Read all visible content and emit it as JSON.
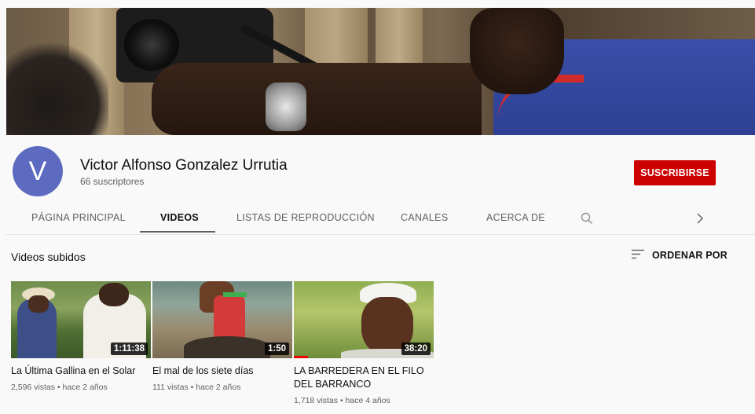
{
  "channel": {
    "avatar_letter": "V",
    "avatar_color": "#5c6bc0",
    "name": "Victor Alfonso Gonzalez Urrutia",
    "subscribers": "66 suscriptores",
    "subscribe_label": "SUSCRIBIRSE",
    "subscribe_color": "#cc0000"
  },
  "tabs": [
    {
      "label": "PÁGINA PRINCIPAL",
      "active": false
    },
    {
      "label": "VIDEOS",
      "active": true
    },
    {
      "label": "LISTAS DE REPRODUCCIÓN",
      "active": false
    },
    {
      "label": "CANALES",
      "active": false
    },
    {
      "label": "ACERCA DE",
      "active": false
    }
  ],
  "tab_icons": {
    "search": "search-icon",
    "next": "chevron-right-icon"
  },
  "section": {
    "title": "Videos subidos",
    "sort_label": "ORDENAR POR",
    "sort_icon": "sort-icon"
  },
  "videos": [
    {
      "title": "La Última Gallina en el Solar",
      "duration": "1:11:38",
      "meta": "2,596 vistas • hace 2 años"
    },
    {
      "title": "El mal de los siete días",
      "duration": "1:50",
      "meta": "111 vistas • hace 2 años"
    },
    {
      "title": "LA BARREDERA EN EL FILO DEL BARRANCO",
      "duration": "38:20",
      "meta": "1,718 vistas • hace 4 años"
    }
  ]
}
